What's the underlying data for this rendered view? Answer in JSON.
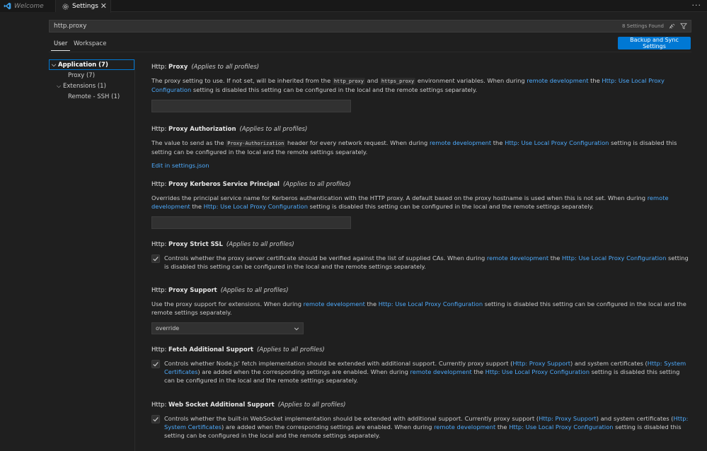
{
  "tabs": {
    "welcome": "Welcome",
    "settings": "Settings",
    "close": "✕",
    "more": "···"
  },
  "search": {
    "value": "http.proxy",
    "count": "8 Settings Found"
  },
  "scopes": {
    "user": "User",
    "workspace": "Workspace"
  },
  "sync_button": "Backup and Sync Settings",
  "toc": [
    {
      "label": "Application (7)"
    },
    {
      "label": "Proxy (7)"
    },
    {
      "label": "Extensions (1)"
    },
    {
      "label": "Remote - SSH (1)"
    }
  ],
  "common": {
    "cat": "Http: ",
    "applies": "(Applies to all profiles)",
    "remote_dev": "remote development",
    "the": " the ",
    "use_local": "Http: Use Local Proxy Configuration",
    "disabled_tail": " setting is disabled this setting can be configured in the local and the remote settings separately."
  },
  "settings": {
    "proxy": {
      "key": "Proxy",
      "desc_a": "The proxy setting to use. If not set, will be inherited from the ",
      "code1": "http_proxy",
      "and": " and ",
      "code2": "https_proxy",
      "desc_b": " environment variables. When during ",
      "value": ""
    },
    "proxy_auth": {
      "key": "Proxy Authorization",
      "desc_a": "The value to send as the ",
      "code": "Proxy-Authorization",
      "desc_b": " header for every network request. When during ",
      "edit": "Edit in settings.json"
    },
    "kerberos": {
      "key": "Proxy Kerberos Service Principal",
      "desc_a": "Overrides the principal service name for Kerberos authentication with the HTTP proxy. A default based on the proxy hostname is used when this is not set. When during ",
      "value": ""
    },
    "strict_ssl": {
      "key": "Proxy Strict SSL",
      "desc_a": "Controls whether the proxy server certificate should be verified against the list of supplied CAs. When during "
    },
    "proxy_support": {
      "key": "Proxy Support",
      "desc_a": "Use the proxy support for extensions. When during ",
      "selected": "override"
    },
    "fetch": {
      "key": "Fetch Additional Support",
      "desc_a": "Controls whether Node.js' fetch implementation should be extended with additional support. Currently proxy support (",
      "link1": "Http: Proxy Support",
      "mid": ") and system certificates (",
      "link2": "Http: System Certificates",
      "desc_b": ") are added when the corresponding settings are enabled. When during "
    },
    "websocket": {
      "key": "Web Socket Additional Support",
      "desc_a": "Controls whether the built-in WebSocket implementation should be extended with additional support. Currently proxy support (",
      "link1": "Http: Proxy Support",
      "mid": ") and system certificates (",
      "link2": "Http: System Certificates",
      "desc_b": ") are added when the corresponding settings are enabled. When during "
    }
  },
  "colors": {
    "accent": "#0078d4",
    "link": "#4daafc",
    "background": "#1f1f1f"
  }
}
